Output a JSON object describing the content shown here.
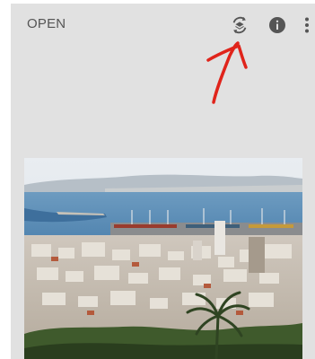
{
  "header": {
    "open_label": "OPEN",
    "icons": {
      "looks": "layers-stack-icon",
      "info": "info-icon",
      "more": "more-vert-icon"
    }
  },
  "annotation": {
    "color": "#e0241b",
    "kind": "hand-drawn-arrow"
  },
  "image": {
    "subject": "city-harbor-photo"
  },
  "colors": {
    "background": "#e1e1e1",
    "icon": "#555555",
    "text": "#555555"
  }
}
